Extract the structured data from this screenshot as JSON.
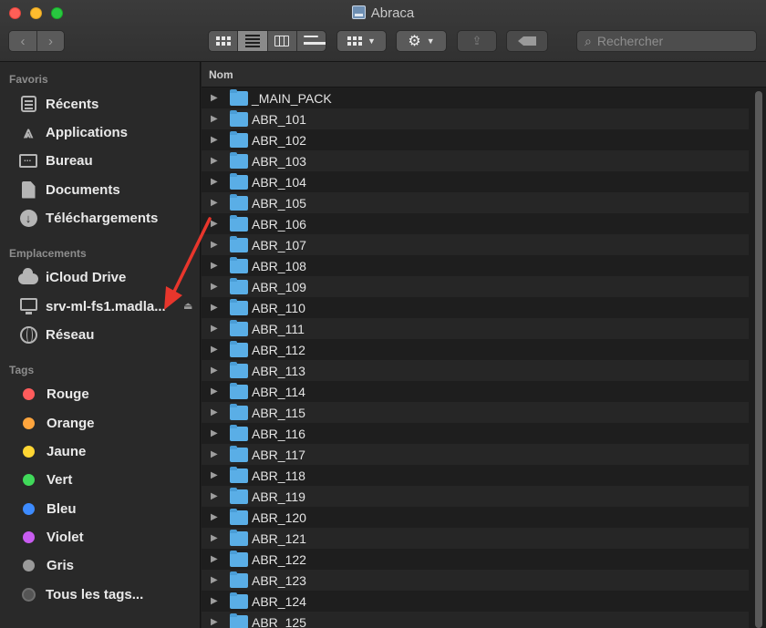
{
  "window": {
    "title": "Abraca"
  },
  "toolbar": {
    "search_placeholder": "Rechercher"
  },
  "sidebar": {
    "sections": {
      "favorites": "Favoris",
      "locations": "Emplacements",
      "tags": "Tags"
    },
    "favorites": [
      {
        "label": "Récents",
        "icon": "recents-icon"
      },
      {
        "label": "Applications",
        "icon": "applications-icon"
      },
      {
        "label": "Bureau",
        "icon": "desktop-icon"
      },
      {
        "label": "Documents",
        "icon": "documents-icon"
      },
      {
        "label": "Téléchargements",
        "icon": "downloads-icon"
      }
    ],
    "locations": [
      {
        "label": "iCloud Drive",
        "icon": "icloud-icon"
      },
      {
        "label": "srv-ml-fs1.madla...",
        "icon": "server-icon"
      },
      {
        "label": "Réseau",
        "icon": "network-icon"
      }
    ],
    "tags": [
      {
        "label": "Rouge",
        "color": "#ff5c5c"
      },
      {
        "label": "Orange",
        "color": "#ffa53d"
      },
      {
        "label": "Jaune",
        "color": "#ffd633"
      },
      {
        "label": "Vert",
        "color": "#40d95a"
      },
      {
        "label": "Bleu",
        "color": "#3d8bff"
      },
      {
        "label": "Violet",
        "color": "#c85cf0"
      },
      {
        "label": "Gris",
        "color": "#9a9a9a"
      },
      {
        "label": "Tous les tags...",
        "color": ""
      }
    ]
  },
  "list": {
    "column_name": "Nom",
    "items": [
      "_MAIN_PACK",
      "ABR_101",
      "ABR_102",
      "ABR_103",
      "ABR_104",
      "ABR_105",
      "ABR_106",
      "ABR_107",
      "ABR_108",
      "ABR_109",
      "ABR_110",
      "ABR_111",
      "ABR_112",
      "ABR_113",
      "ABR_114",
      "ABR_115",
      "ABR_116",
      "ABR_117",
      "ABR_118",
      "ABR_119",
      "ABR_120",
      "ABR_121",
      "ABR_122",
      "ABR_123",
      "ABR_124",
      "ABR_125"
    ]
  }
}
